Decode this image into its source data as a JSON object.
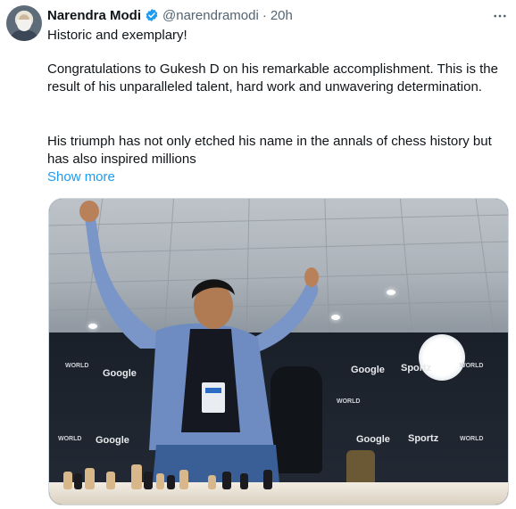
{
  "tweet": {
    "author_name": "Narendra Modi",
    "handle": "@narendramodi",
    "separator": "·",
    "time": "20h",
    "more_label": "⋮",
    "paragraphs": [
      "Historic and exemplary!",
      "Congratulations to Gukesh D on his remarkable accomplishment. This is the result of his unparalleled talent, hard work and unwavering determination.",
      "His triumph has not only etched his name in the annals of chess history but has also inspired millions"
    ],
    "show_more": "Show more"
  },
  "photo": {
    "sponsors": [
      "Google",
      "Google",
      "Google",
      "Google",
      "Sportz",
      "Sportz"
    ],
    "small_labels": [
      "WORLD",
      "WORLD",
      "WORLD",
      "WORLD",
      "WORLD"
    ]
  },
  "colors": {
    "link": "#1d9bf0",
    "verified": "#1d9bf0",
    "muted": "#536471",
    "text": "#0f1419"
  },
  "icons": {
    "verified": "verified-badge-icon",
    "more": "more-options-icon"
  }
}
